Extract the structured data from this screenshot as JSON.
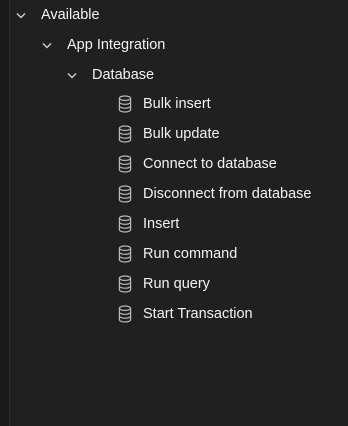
{
  "tree": {
    "root": {
      "label": "Available",
      "icon": "chevron-down-icon",
      "expanded": true
    },
    "group": {
      "label": "App Integration",
      "icon": "chevron-down-icon",
      "expanded": true
    },
    "category": {
      "label": "Database",
      "icon": "chevron-down-icon",
      "expanded": true
    },
    "activities": [
      {
        "label": "Bulk insert",
        "icon": "database-icon"
      },
      {
        "label": "Bulk update",
        "icon": "database-icon"
      },
      {
        "label": "Connect to database",
        "icon": "database-icon"
      },
      {
        "label": "Disconnect from database",
        "icon": "database-icon"
      },
      {
        "label": "Insert",
        "icon": "database-icon"
      },
      {
        "label": "Run command",
        "icon": "database-icon"
      },
      {
        "label": "Run query",
        "icon": "database-icon"
      },
      {
        "label": "Start Transaction",
        "icon": "database-icon"
      }
    ]
  },
  "colors": {
    "background": "#202020",
    "text": "#f2f2f2",
    "icon": "#b8b8b8"
  }
}
